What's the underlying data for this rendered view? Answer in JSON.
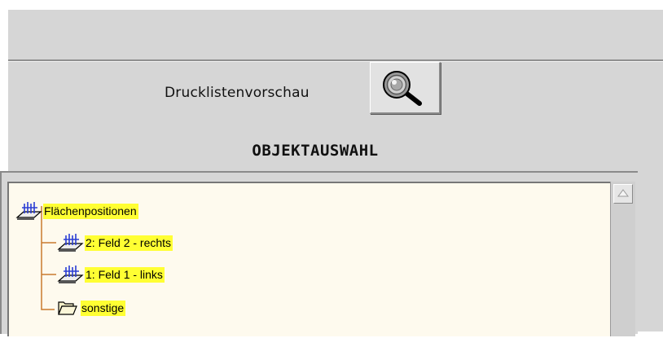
{
  "preview": {
    "label": "Drucklistenvorschau",
    "icon": "magnifier-icon"
  },
  "section": {
    "title": "OBJEKTAUSWAHL"
  },
  "tree": {
    "root": {
      "label": "Flächenpositionen",
      "icon": "surface-positions-icon"
    },
    "children": [
      {
        "label": "2: Feld 2 - rechts",
        "icon": "surface-positions-icon"
      },
      {
        "label": "1: Feld 1 - links",
        "icon": "surface-positions-icon"
      },
      {
        "label": "sonstige",
        "icon": "folder-open-icon"
      }
    ]
  },
  "colors": {
    "panel": "#d6d6d6",
    "tree_background": "#fefaee",
    "highlight": "#ffff33",
    "tree_line": "#c87a2e",
    "icon_blue": "#2a3dd4"
  }
}
